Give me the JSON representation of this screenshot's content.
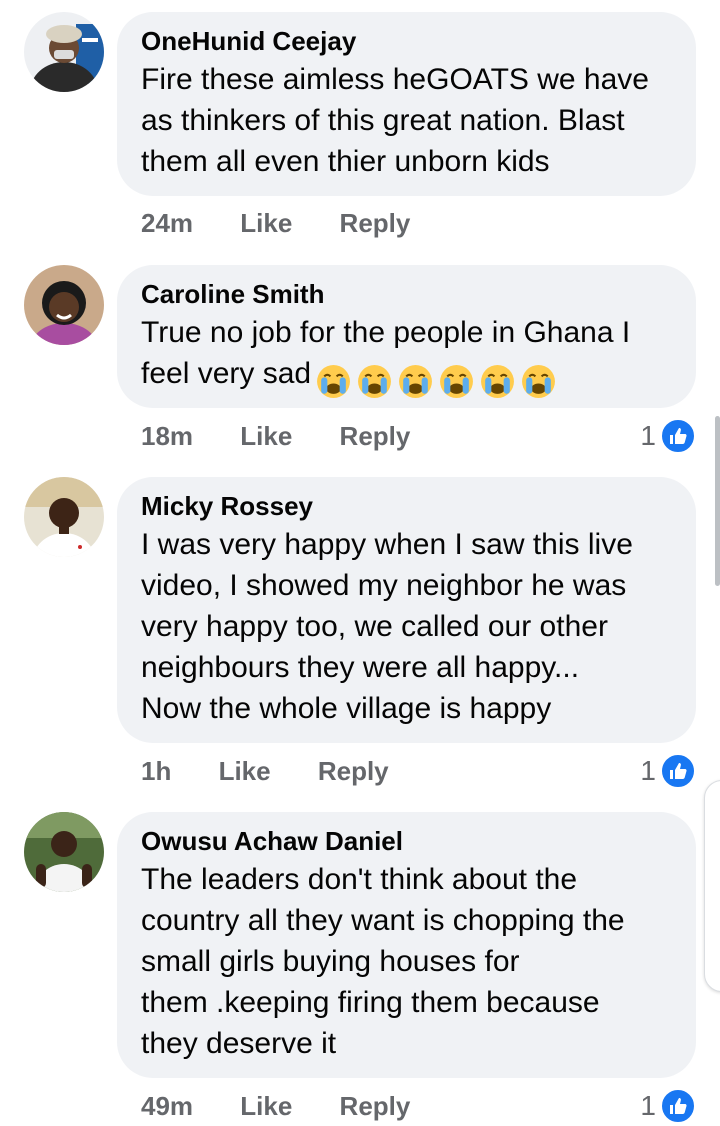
{
  "comments": [
    {
      "author": "OneHunid Ceejay",
      "lines": [
        "Fire these aimless heGOATS we have",
        "as thinkers of this great nation. Blast",
        "them all even thier unborn kids"
      ],
      "time": "24m",
      "like_label": "Like",
      "reply_label": "Reply",
      "reaction_count": null
    },
    {
      "author": "Caroline Smith",
      "lines": [
        "True no job  for the people in Ghana  I",
        "feel very sad"
      ],
      "emoji_icons": [
        "loudly-crying-face-icon",
        "loudly-crying-face-icon",
        "loudly-crying-face-icon",
        "loudly-crying-face-icon",
        "loudly-crying-face-icon",
        "loudly-crying-face-icon"
      ],
      "time": "18m",
      "like_label": "Like",
      "reply_label": "Reply",
      "reaction_count": "1"
    },
    {
      "author": "Micky Rossey",
      "lines": [
        "I was very happy when I saw this live",
        "video, I showed my neighbor he was",
        "very happy too, we called our other",
        "neighbours they were all happy...",
        "Now the whole village is happy"
      ],
      "time": "1h",
      "like_label": "Like",
      "reply_label": "Reply",
      "reaction_count": "1"
    },
    {
      "author": "Owusu Achaw Daniel",
      "lines": [
        "The leaders don't think about the",
        "country all they want is chopping the",
        "small girls buying houses for",
        "them .keeping firing them because",
        "they deserve it"
      ],
      "time": "49m",
      "like_label": "Like",
      "reply_label": "Reply",
      "reaction_count": "1"
    }
  ],
  "colors": {
    "bubble": "#f0f2f5",
    "meta": "#65676b",
    "like_blue": "#1877f2",
    "text": "#050505"
  },
  "icons": {
    "reaction": "thumbs-up-icon"
  }
}
